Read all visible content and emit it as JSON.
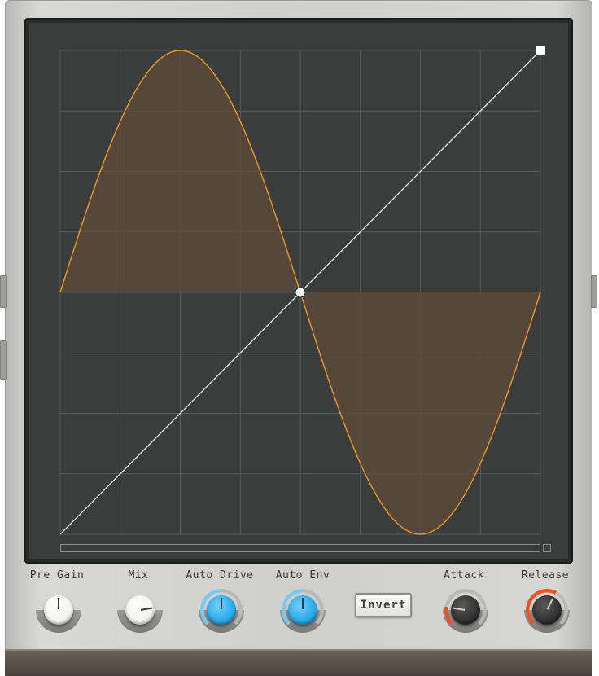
{
  "colors": {
    "accent_orange": "#e7902a",
    "curve_fill": "#5a4a3a",
    "grid_line": "#5a5c5c",
    "knob_blue": "#2aa9e8",
    "ring_blue": "#7cc8ee",
    "ring_red": "#e5552a",
    "knob_white": "#f2f2f0",
    "knob_dark": "#2d2d2d"
  },
  "graph": {
    "grid_divisions": 8,
    "input_range": [
      -1,
      1
    ],
    "output_range": [
      -1,
      1
    ],
    "transfer_curve": "sine",
    "linear_reference": true,
    "control_points": [
      {
        "x": 0,
        "y": 0
      },
      {
        "x": 1,
        "y": 1
      }
    ]
  },
  "controls": {
    "pre_gain": {
      "label": "Pre Gain",
      "icon": "knob-icon",
      "value": 0.5,
      "style": "white"
    },
    "mix": {
      "label": "Mix",
      "icon": "knob-icon",
      "value": 0.8,
      "style": "white"
    },
    "auto_drive": {
      "label": "Auto Drive",
      "icon": "knob-icon",
      "value": 0.5,
      "style": "blue"
    },
    "auto_env": {
      "label": "Auto Env",
      "icon": "knob-icon",
      "value": 0.5,
      "style": "blue"
    },
    "invert": {
      "label": "Invert"
    },
    "attack": {
      "label": "Attack",
      "icon": "knob-icon",
      "value": 0.2,
      "style": "dark"
    },
    "release": {
      "label": "Release",
      "icon": "knob-icon",
      "value": 0.6,
      "style": "dark"
    }
  }
}
